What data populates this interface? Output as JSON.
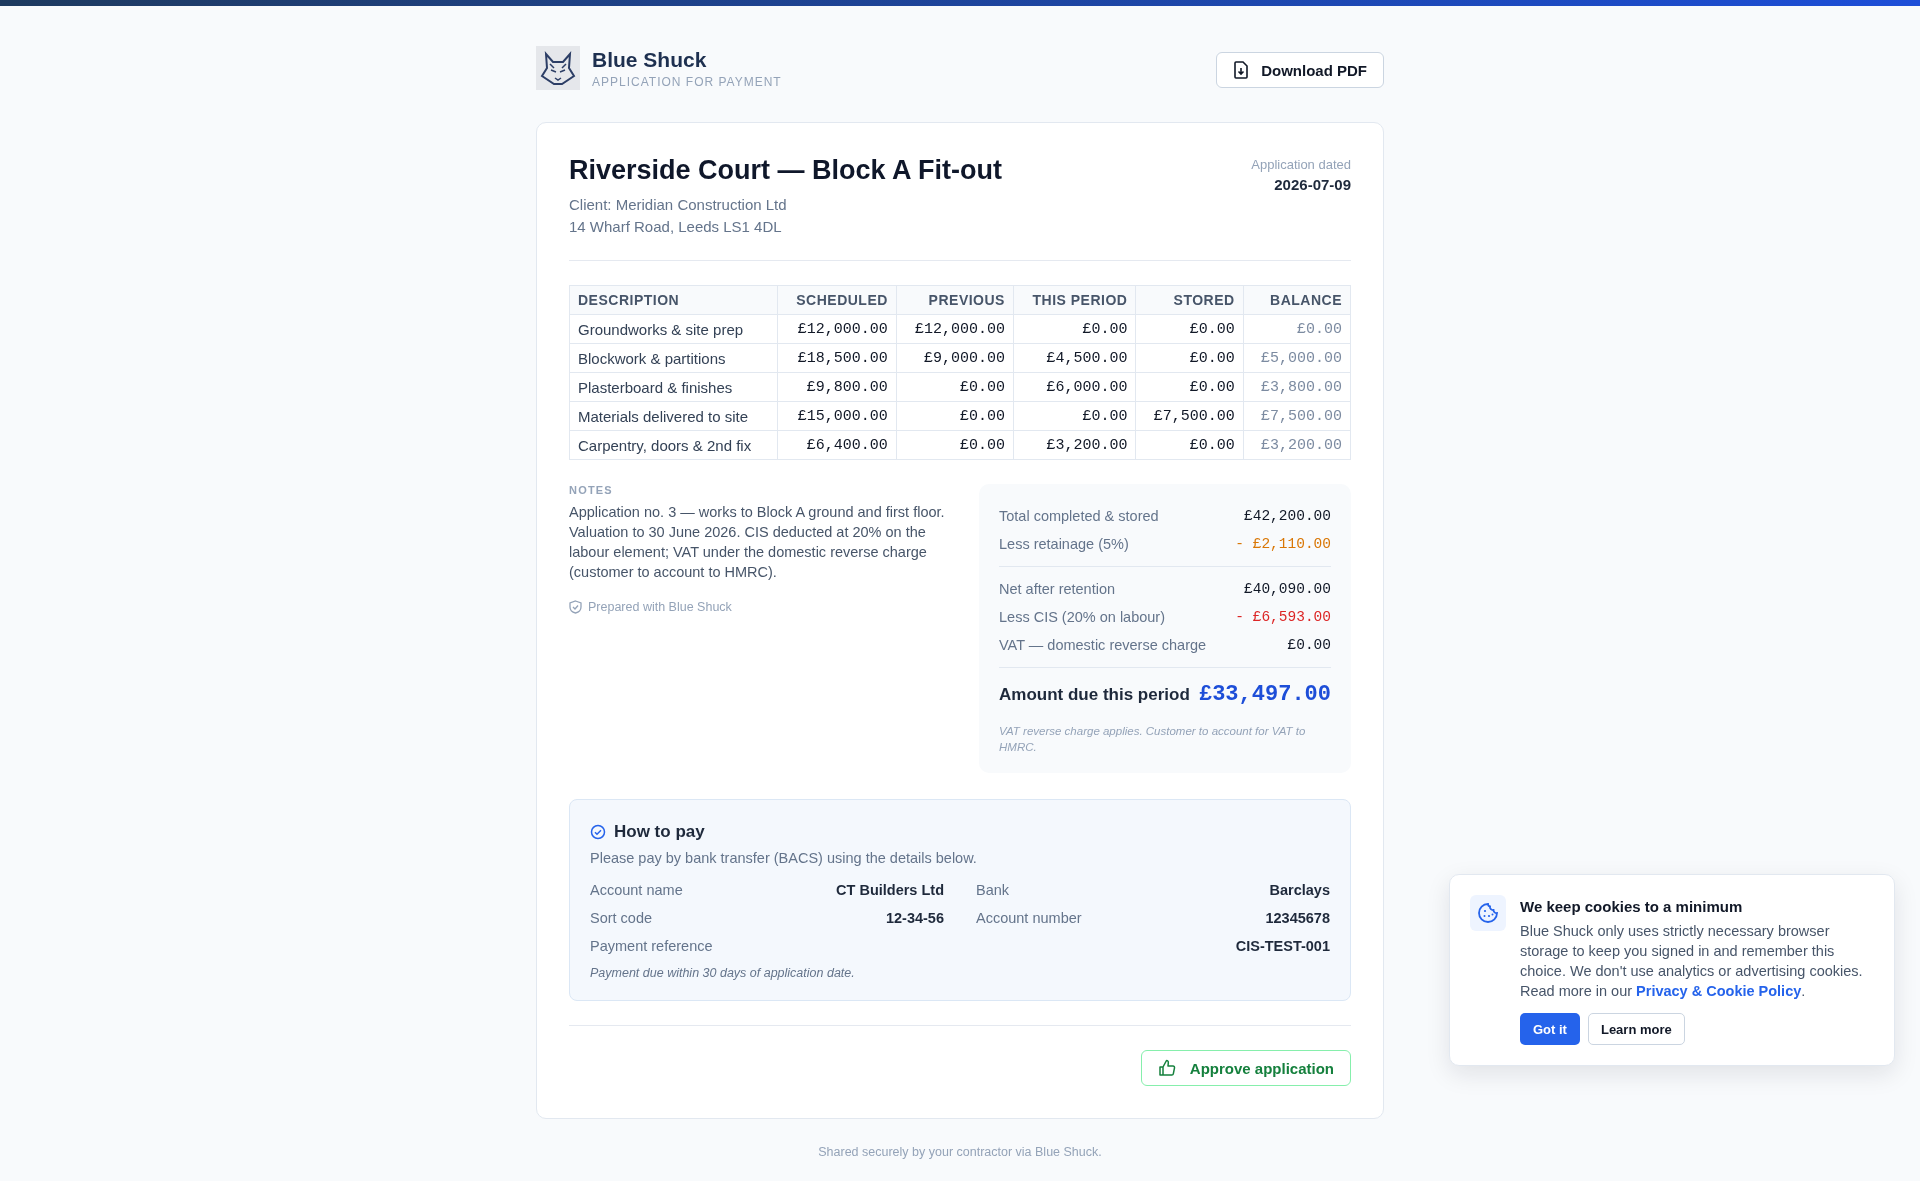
{
  "brand": {
    "name": "Blue Shuck",
    "subtitle": "APPLICATION FOR PAYMENT"
  },
  "download_button": "Download PDF",
  "project": {
    "title": "Riverside Court — Block A Fit-out",
    "client": "Client: Meridian Construction Ltd",
    "address": "14 Wharf Road, Leeds LS1 4DL",
    "date_label": "Application dated",
    "date": "2026-07-09"
  },
  "table": {
    "columns": [
      "DESCRIPTION",
      "SCHEDULED",
      "PREVIOUS",
      "THIS PERIOD",
      "STORED",
      "BALANCE"
    ],
    "rows": [
      [
        "Groundworks & site prep",
        "£12,000.00",
        "£12,000.00",
        "£0.00",
        "£0.00",
        "£0.00"
      ],
      [
        "Blockwork & partitions",
        "£18,500.00",
        "£9,000.00",
        "£4,500.00",
        "£0.00",
        "£5,000.00"
      ],
      [
        "Plasterboard & finishes",
        "£9,800.00",
        "£0.00",
        "£6,000.00",
        "£0.00",
        "£3,800.00"
      ],
      [
        "Materials delivered to site",
        "£15,000.00",
        "£0.00",
        "£0.00",
        "£7,500.00",
        "£7,500.00"
      ],
      [
        "Carpentry, doors & 2nd fix",
        "£6,400.00",
        "£0.00",
        "£3,200.00",
        "£0.00",
        "£3,200.00"
      ]
    ]
  },
  "notes": {
    "heading": "NOTES",
    "text": "Application no. 3 — works to Block A ground and first floor. Valuation to 30 June 2026. CIS deducted at 20% on the labour element; VAT under the domestic reverse charge (customer to account to HMRC).",
    "prepared": "Prepared with Blue Shuck"
  },
  "summary": {
    "groups": [
      [
        {
          "label": "Total completed & stored",
          "value": "£42,200.00",
          "kind": "plain"
        },
        {
          "label": "Less retainage (5%)",
          "value": "- £2,110.00",
          "kind": "retainage"
        }
      ],
      [
        {
          "label": "Net after retention",
          "value": "£40,090.00",
          "kind": "plain"
        },
        {
          "label": "Less CIS (20% on labour)",
          "value": "- £6,593.00",
          "kind": "deduction"
        },
        {
          "label": "VAT — domestic reverse charge",
          "value": "£0.00",
          "kind": "plain"
        }
      ]
    ],
    "total_label": "Amount due this period",
    "total_value": "£33,497.00",
    "footnote": "VAT reverse charge applies. Customer to account for VAT to HMRC."
  },
  "how_to_pay": {
    "title": "How to pay",
    "intro": "Please pay by bank transfer (BACS) using the details below.",
    "details": [
      {
        "label": "Account name",
        "value": "CT Builders Ltd"
      },
      {
        "label": "Bank",
        "value": "Barclays"
      },
      {
        "label": "Sort code",
        "value": "12-34-56"
      },
      {
        "label": "Account number",
        "value": "12345678"
      }
    ],
    "reference": {
      "label": "Payment reference",
      "value": "CIS-TEST-001"
    },
    "due_note": "Payment due within 30 days of application date."
  },
  "approve_button": "Approve application",
  "footer": "Shared securely by your contractor via Blue Shuck.",
  "cookie_banner": {
    "title": "We keep cookies to a minimum",
    "text": "Blue Shuck only uses strictly necessary browser storage to keep you signed in and remember this choice. We don't use analytics or advertising cookies. Read more in our",
    "link": "Privacy & Cookie Policy",
    "after_link": ".",
    "accept": "Got it",
    "learn_more": "Learn more"
  }
}
